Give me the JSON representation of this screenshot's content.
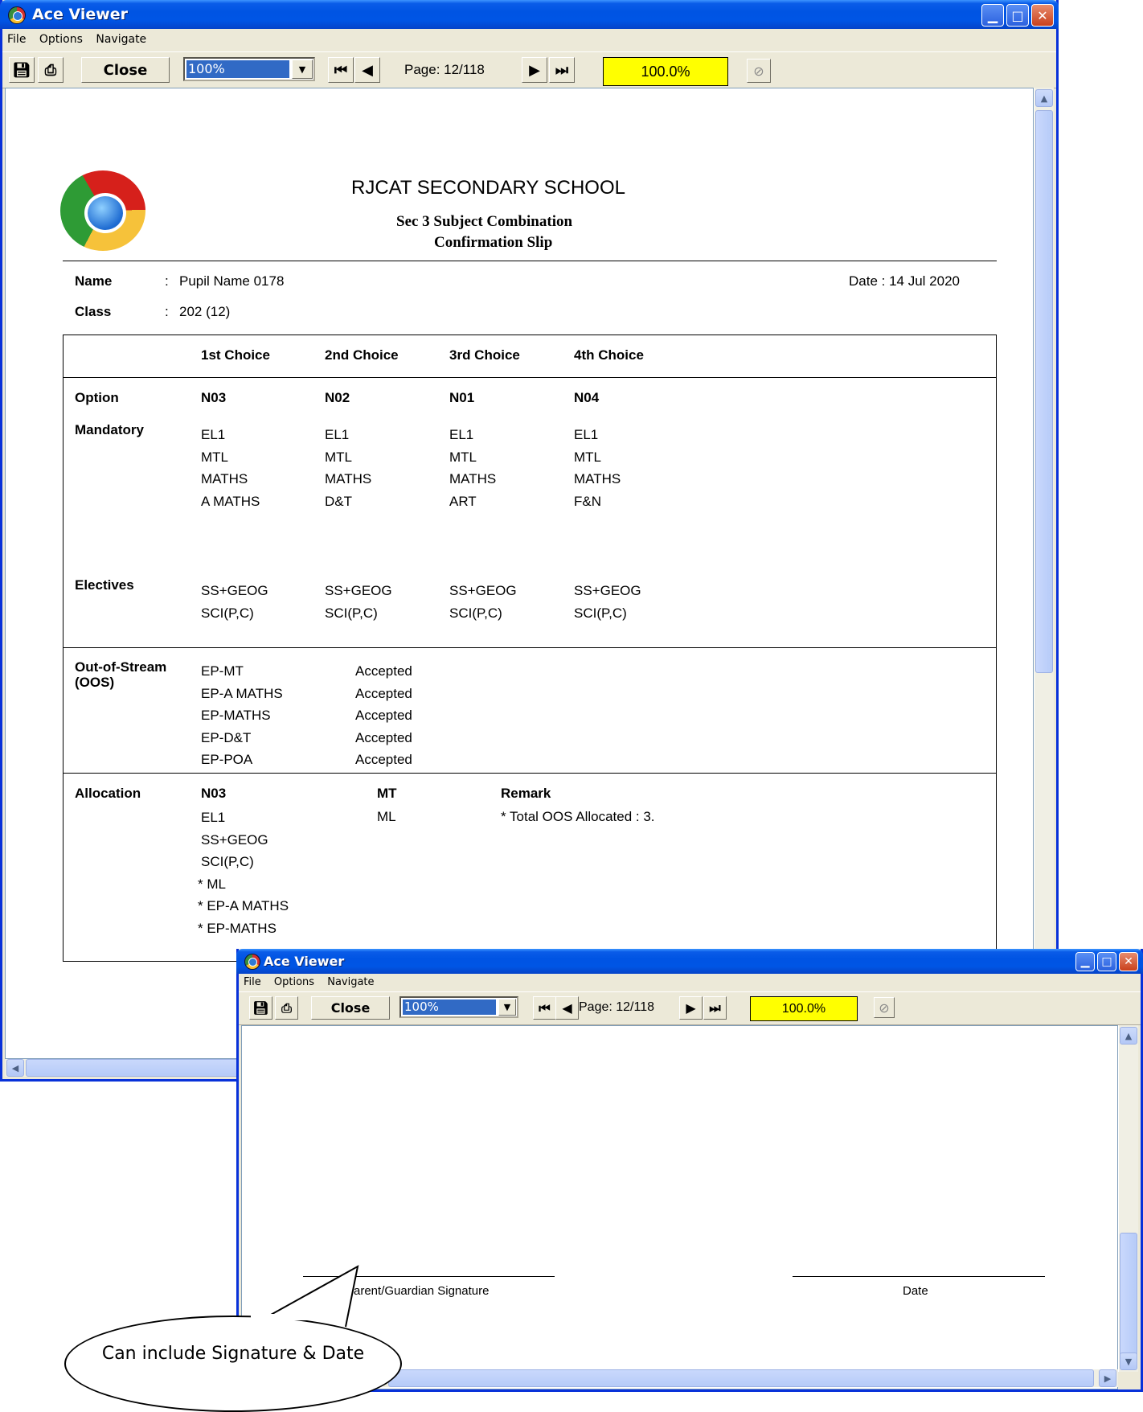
{
  "window": {
    "title": "Ace Viewer",
    "menu": [
      "File",
      "Options",
      "Navigate"
    ],
    "toolbar": {
      "close_label": "Close",
      "zoom_select": "100%",
      "page_info": "Page: 12/118",
      "zoom_display": "100.0%"
    }
  },
  "report": {
    "school": "RJCAT SECONDARY SCHOOL",
    "subtitle1": "Sec 3 Subject Combination",
    "subtitle2": "Confirmation Slip",
    "name_label": "Name",
    "name_value": "Pupil Name 0178",
    "class_label": "Class",
    "class_value": "202 (12)",
    "date": "Date : 14 Jul 2020",
    "choice_headers": [
      "1st Choice",
      "2nd Choice",
      "3rd Choice",
      "4th Choice"
    ],
    "option_label": "Option",
    "options": [
      "N03",
      "N02",
      "N01",
      "N04"
    ],
    "mandatory_label": "Mandatory",
    "mandatory": [
      [
        "EL1",
        "MTL",
        "MATHS",
        "A MATHS"
      ],
      [
        "EL1",
        "MTL",
        "MATHS",
        "D&T"
      ],
      [
        "EL1",
        "MTL",
        "MATHS",
        "ART"
      ],
      [
        "EL1",
        "MTL",
        "MATHS",
        "F&N"
      ]
    ],
    "electives_label": "Electives",
    "electives": [
      [
        "SS+GEOG",
        "SCI(P,C)"
      ],
      [
        "SS+GEOG",
        "SCI(P,C)"
      ],
      [
        "SS+GEOG",
        "SCI(P,C)"
      ],
      [
        "SS+GEOG",
        "SCI(P,C)"
      ]
    ],
    "oos_label_1": "Out-of-Stream",
    "oos_label_2": "(OOS)",
    "oos": [
      {
        "subject": "EP-MT",
        "status": "Accepted"
      },
      {
        "subject": "EP-A MATHS",
        "status": "Accepted"
      },
      {
        "subject": "EP-MATHS",
        "status": "Accepted"
      },
      {
        "subject": "EP-D&T",
        "status": "Accepted"
      },
      {
        "subject": "EP-POA",
        "status": "Accepted"
      }
    ],
    "allocation_label": "Allocation",
    "allocation": [
      "N03",
      "EL1",
      "SS+GEOG",
      "SCI(P,C)",
      "* ML",
      "* EP-A MATHS",
      "* EP-MATHS"
    ],
    "mt_header": "MT",
    "mt_value": "ML",
    "remark_header": "Remark",
    "remark_value": "* Total OOS Allocated : 3.",
    "colon": ":"
  },
  "page2": {
    "signature_label": "Parent/Guardian Signature",
    "date_label": "Date"
  },
  "callout": "Can include Signature & Date",
  "colors": {
    "title_blue": "#0054e3",
    "zoom_yellow": "#ffff00",
    "selection_blue": "#316ac5"
  }
}
